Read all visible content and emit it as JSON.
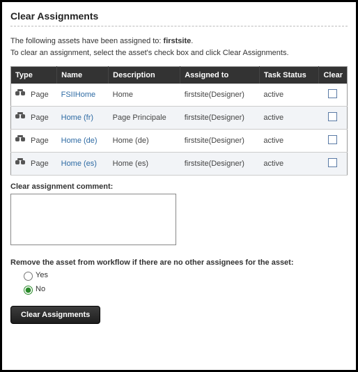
{
  "title": "Clear Assignments",
  "intro_prefix": "The following assets have been assigned to: ",
  "intro_site": "firstsite",
  "intro_suffix": ".",
  "instruction": "To clear an assignment, select the asset's check box and click Clear Assignments.",
  "columns": {
    "type": "Type",
    "name": "Name",
    "description": "Description",
    "assigned_to": "Assigned to",
    "task_status": "Task Status",
    "clear": "Clear"
  },
  "rows": [
    {
      "type": "Page",
      "name": "FSIIHome",
      "description": "Home",
      "assigned_to": "firstsite(Designer)",
      "task_status": "active"
    },
    {
      "type": "Page",
      "name": "Home (fr)",
      "description": "Page Principale",
      "assigned_to": "firstsite(Designer)",
      "task_status": "active"
    },
    {
      "type": "Page",
      "name": "Home (de)",
      "description": "Home (de)",
      "assigned_to": "firstsite(Designer)",
      "task_status": "active"
    },
    {
      "type": "Page",
      "name": "Home (es)",
      "description": "Home (es)",
      "assigned_to": "firstsite(Designer)",
      "task_status": "active"
    }
  ],
  "comment_label": "Clear assignment comment:",
  "comment_value": "",
  "remove_label": "Remove the asset from workflow if there are no other assignees for the asset:",
  "radio_yes": "Yes",
  "radio_no": "No",
  "button_label": "Clear Assignments"
}
